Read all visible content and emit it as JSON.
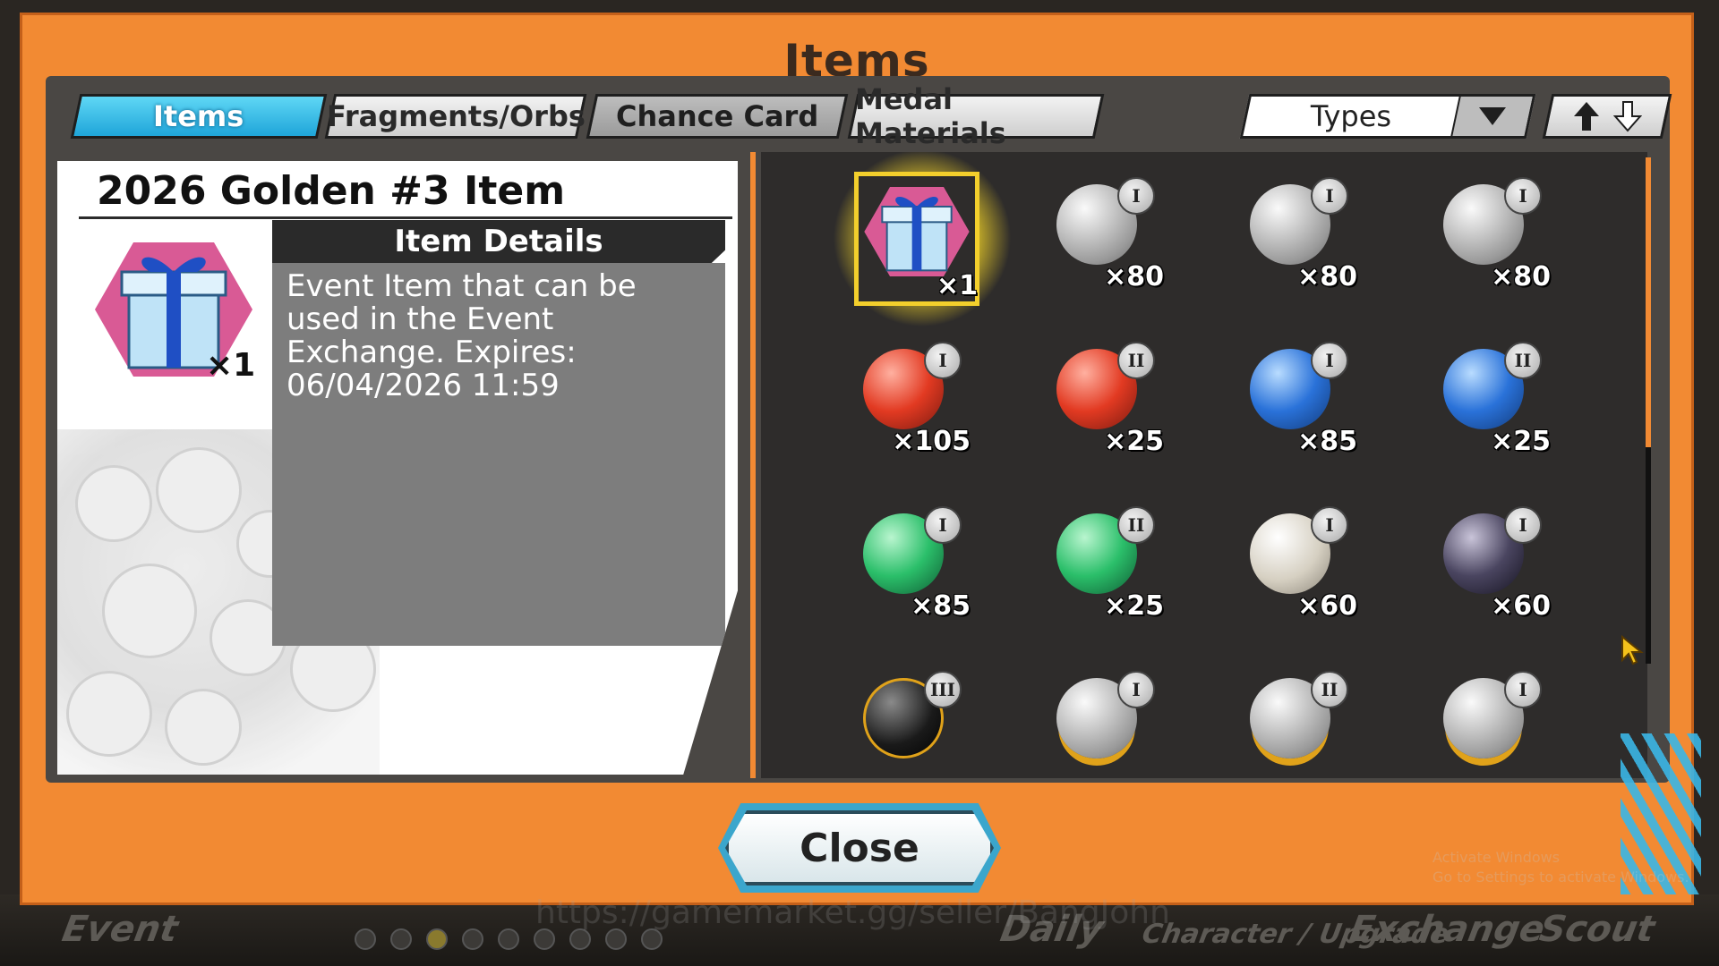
{
  "dialog": {
    "title": "Items",
    "close_label": "Close"
  },
  "tabs": [
    {
      "label": "Items",
      "active": true
    },
    {
      "label": "Fragments/Orbs",
      "active": false
    },
    {
      "label": "Chance Card",
      "active": false
    },
    {
      "label": "Medal Materials",
      "active": false
    }
  ],
  "filter": {
    "types_label": "Types"
  },
  "selected_item": {
    "name": "2026 Golden #3 Item",
    "quantity": "×1",
    "details_heading": "Item Details",
    "description": "Event Item that can be used in the Event Exchange. Expires: 06/04/2026 11:59"
  },
  "grid_items": [
    {
      "icon": "gift-box-icon",
      "tier": "",
      "qty": "×1",
      "selected": true
    },
    {
      "icon": "medal-material-a-icon",
      "tier": "I",
      "qty": "×80"
    },
    {
      "icon": "shield-material-icon",
      "tier": "I",
      "qty": "×80"
    },
    {
      "icon": "boot-material-icon",
      "tier": "I",
      "qty": "×80"
    },
    {
      "icon": "red-orb-icon",
      "tier": "I",
      "qty": "×105"
    },
    {
      "icon": "red-orb-icon",
      "tier": "II",
      "qty": "×25"
    },
    {
      "icon": "blue-orb-icon",
      "tier": "I",
      "qty": "×85"
    },
    {
      "icon": "blue-orb-icon",
      "tier": "II",
      "qty": "×25"
    },
    {
      "icon": "green-orb-icon",
      "tier": "I",
      "qty": "×85"
    },
    {
      "icon": "green-orb-icon",
      "tier": "II",
      "qty": "×25"
    },
    {
      "icon": "white-orb-icon",
      "tier": "I",
      "qty": "×60"
    },
    {
      "icon": "dark-orb-icon",
      "tier": "I",
      "qty": "×60"
    },
    {
      "icon": "black-orb-icon",
      "tier": "III",
      "qty": ""
    },
    {
      "icon": "heart-medal-icon",
      "tier": "I",
      "qty": ""
    },
    {
      "icon": "heart-medal-icon",
      "tier": "II",
      "qty": ""
    },
    {
      "icon": "sword-medal-icon",
      "tier": "I",
      "qty": ""
    }
  ],
  "background": {
    "nav_labels": [
      "Event",
      "Daily",
      "Character / Upgrade",
      "Exchange",
      "Scout"
    ],
    "watermark": "https://gamemarket.gg/seller/BangJohn",
    "activate_line1": "Activate Windows",
    "activate_line2": "Go to Settings to activate Windows."
  },
  "colors": {
    "dialog_orange": "#f28a33",
    "tab_active": "#1fa5d9",
    "selection_yellow": "#f3cf2c"
  }
}
